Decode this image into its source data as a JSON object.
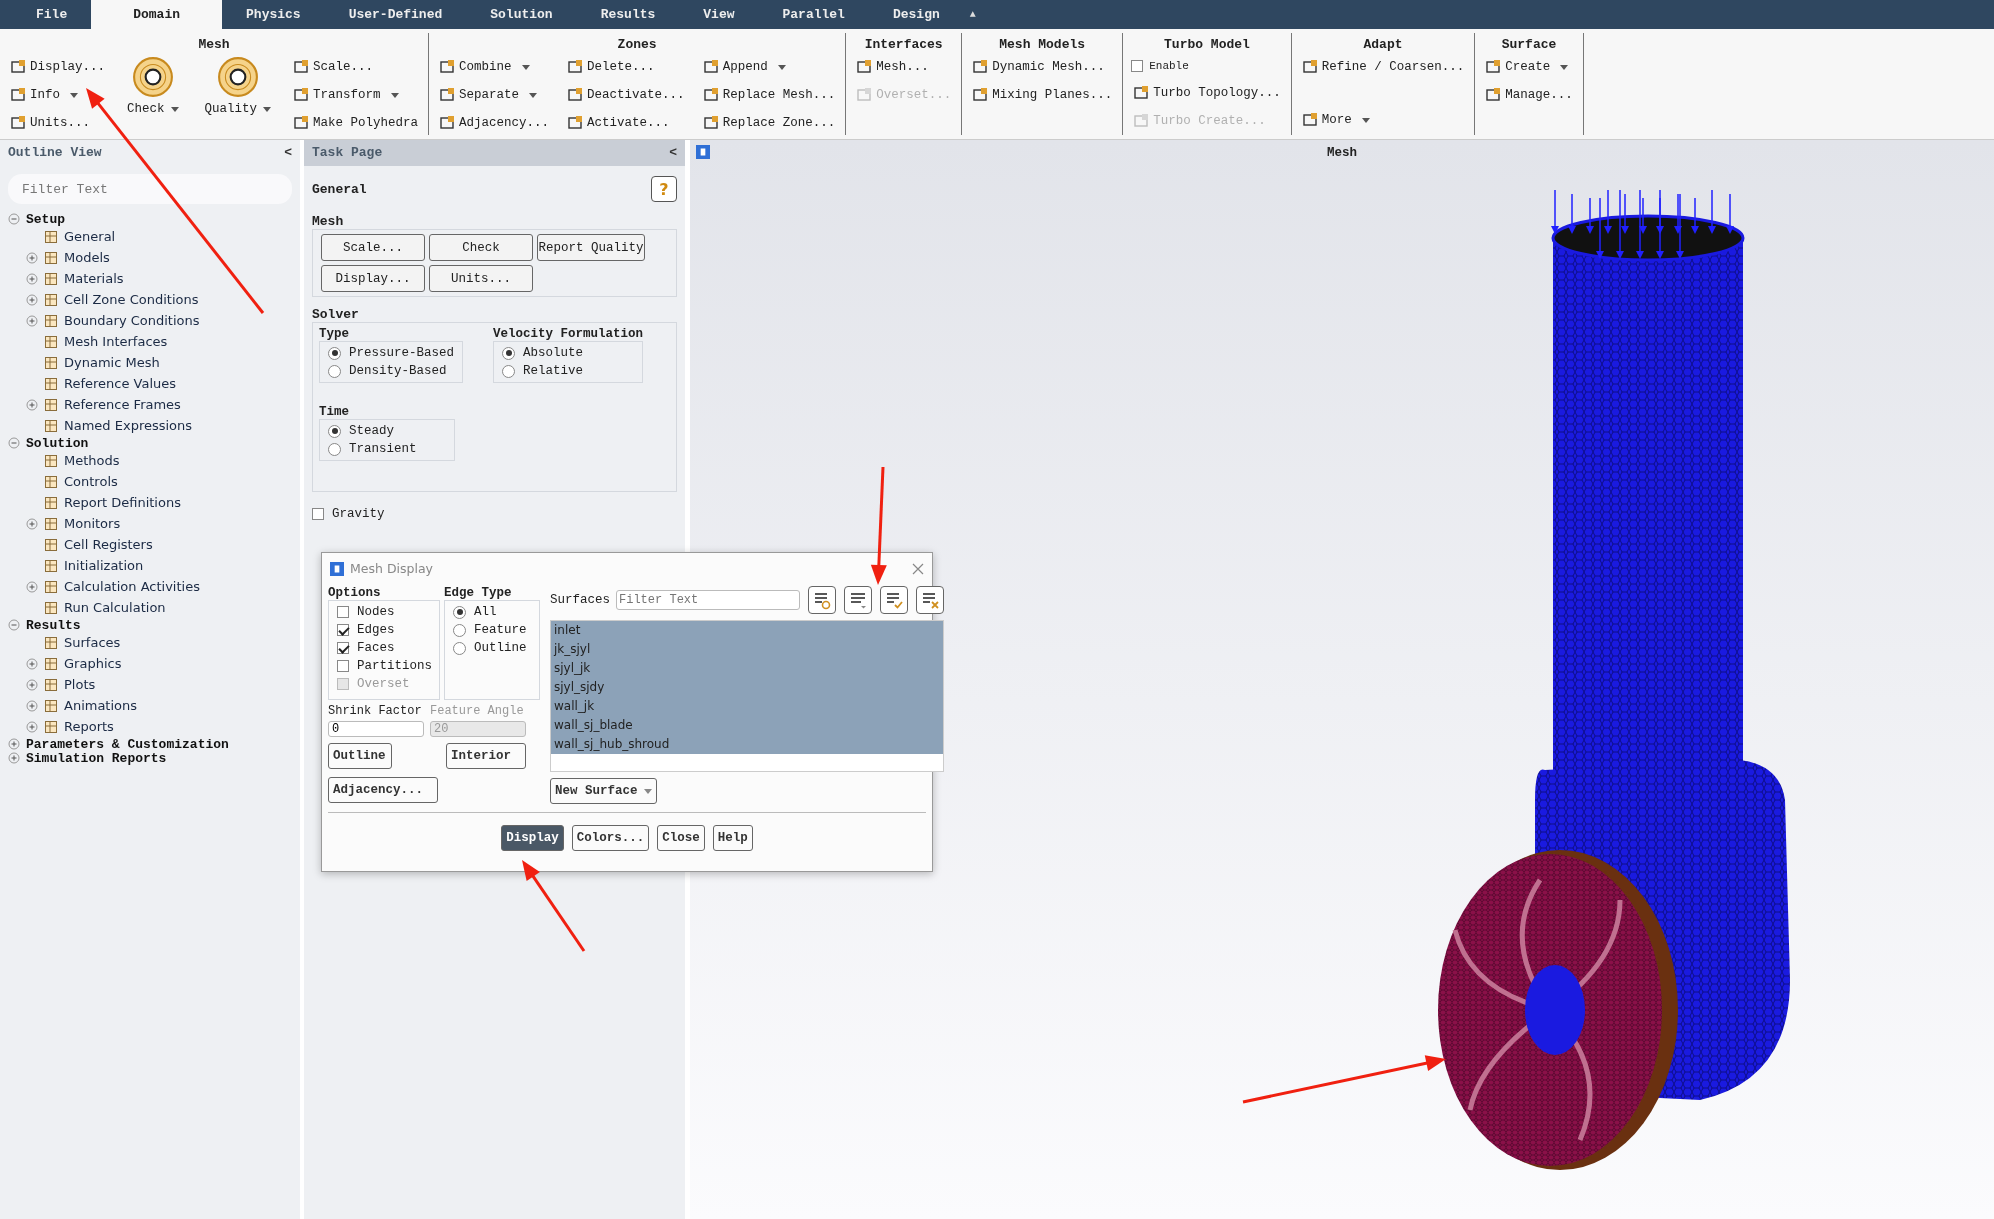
{
  "tabs": [
    {
      "label": "File",
      "selected": false
    },
    {
      "label": "Domain",
      "selected": true
    },
    {
      "label": "Physics",
      "selected": false
    },
    {
      "label": "User-Defined",
      "selected": false
    },
    {
      "label": "Solution",
      "selected": false
    },
    {
      "label": "Results",
      "selected": false
    },
    {
      "label": "View",
      "selected": false
    },
    {
      "label": "Parallel",
      "selected": false
    },
    {
      "label": "Design",
      "selected": false
    }
  ],
  "ribbon_collapse": "▲",
  "ribbon": [
    {
      "title": "Mesh",
      "columns": [
        {
          "items": [
            {
              "kind": "button",
              "label": "Display...",
              "dropdown": false,
              "disabled": false
            },
            {
              "kind": "button",
              "label": "Info",
              "dropdown": true,
              "disabled": false
            },
            {
              "kind": "button",
              "label": "Units...",
              "dropdown": false,
              "disabled": false
            }
          ]
        },
        {
          "items": [
            {
              "kind": "big",
              "label": "Check",
              "dropdown": true
            }
          ]
        },
        {
          "items": [
            {
              "kind": "big",
              "label": "Quality",
              "dropdown": true
            }
          ]
        },
        {
          "items": [
            {
              "kind": "button",
              "label": "Scale...",
              "dropdown": false,
              "disabled": false
            },
            {
              "kind": "button",
              "label": "Transform",
              "dropdown": true,
              "disabled": false
            },
            {
              "kind": "button",
              "label": "Make Polyhedra",
              "dropdown": false,
              "disabled": false
            }
          ]
        }
      ]
    },
    {
      "title": "Zones",
      "columns": [
        {
          "items": [
            {
              "kind": "button",
              "label": "Combine",
              "dropdown": true,
              "disabled": false
            },
            {
              "kind": "button",
              "label": "Separate",
              "dropdown": true,
              "disabled": false
            },
            {
              "kind": "button",
              "label": "Adjacency...",
              "dropdown": false,
              "disabled": false
            }
          ]
        },
        {
          "items": [
            {
              "kind": "button",
              "label": "Delete...",
              "dropdown": false,
              "disabled": false
            },
            {
              "kind": "button",
              "label": "Deactivate...",
              "dropdown": false,
              "disabled": false
            },
            {
              "kind": "button",
              "label": "Activate...",
              "dropdown": false,
              "disabled": false
            }
          ]
        },
        {
          "items": [
            {
              "kind": "button",
              "label": "Append",
              "dropdown": true,
              "disabled": false
            },
            {
              "kind": "button",
              "label": "Replace Mesh...",
              "dropdown": false,
              "disabled": false
            },
            {
              "kind": "button",
              "label": "Replace Zone...",
              "dropdown": false,
              "disabled": false
            }
          ]
        }
      ]
    },
    {
      "title": "Interfaces",
      "columns": [
        {
          "items": [
            {
              "kind": "button",
              "label": "Mesh...",
              "dropdown": false,
              "disabled": false
            },
            {
              "kind": "button",
              "label": "Overset...",
              "dropdown": false,
              "disabled": true
            }
          ]
        }
      ]
    },
    {
      "title": "Mesh Models",
      "columns": [
        {
          "items": [
            {
              "kind": "button",
              "label": "Dynamic Mesh...",
              "dropdown": false,
              "disabled": false
            },
            {
              "kind": "button",
              "label": "Mixing Planes...",
              "dropdown": false,
              "disabled": false
            }
          ]
        }
      ]
    },
    {
      "title": "Turbo Model",
      "columns": [
        {
          "items": [
            {
              "kind": "checkbox",
              "label": "Enable",
              "checked": false
            },
            {
              "kind": "button",
              "label": "Turbo Topology...",
              "dropdown": false,
              "disabled": false
            },
            {
              "kind": "button",
              "label": "Turbo Create...",
              "dropdown": false,
              "disabled": true
            }
          ]
        }
      ]
    },
    {
      "title": "Adapt",
      "columns": [
        {
          "spread": true,
          "items": [
            {
              "kind": "button",
              "label": "Refine / Coarsen...",
              "dropdown": false,
              "disabled": false
            },
            {
              "kind": "button",
              "label": "More",
              "dropdown": true,
              "disabled": false
            }
          ]
        }
      ]
    },
    {
      "title": "Surface",
      "columns": [
        {
          "items": [
            {
              "kind": "button",
              "label": "Create",
              "dropdown": true,
              "disabled": false
            },
            {
              "kind": "button",
              "label": "Manage...",
              "dropdown": false,
              "disabled": false
            }
          ]
        }
      ]
    }
  ],
  "outline": {
    "title": "Outline View",
    "collapse": "<",
    "filter": {
      "placeholder": "Filter Text"
    },
    "tree": [
      {
        "label": "Setup",
        "expanded": true,
        "children": [
          {
            "label": "General",
            "has_children": false
          },
          {
            "label": "Models",
            "has_children": true
          },
          {
            "label": "Materials",
            "has_children": true
          },
          {
            "label": "Cell Zone Conditions",
            "has_children": true
          },
          {
            "label": "Boundary Conditions",
            "has_children": true
          },
          {
            "label": "Mesh Interfaces",
            "has_children": false
          },
          {
            "label": "Dynamic Mesh",
            "has_children": false
          },
          {
            "label": "Reference Values",
            "has_children": false
          },
          {
            "label": "Reference Frames",
            "has_children": true
          },
          {
            "label": "Named Expressions",
            "has_children": false
          }
        ]
      },
      {
        "label": "Solution",
        "expanded": true,
        "children": [
          {
            "label": "Methods",
            "has_children": false
          },
          {
            "label": "Controls",
            "has_children": false
          },
          {
            "label": "Report Definitions",
            "has_children": false
          },
          {
            "label": "Monitors",
            "has_children": true
          },
          {
            "label": "Cell Registers",
            "has_children": false
          },
          {
            "label": "Initialization",
            "has_children": false
          },
          {
            "label": "Calculation Activities",
            "has_children": true
          },
          {
            "label": "Run Calculation",
            "has_children": false
          }
        ]
      },
      {
        "label": "Results",
        "expanded": true,
        "children": [
          {
            "label": "Surfaces",
            "has_children": false
          },
          {
            "label": "Graphics",
            "has_children": true
          },
          {
            "label": "Plots",
            "has_children": true
          },
          {
            "label": "Animations",
            "has_children": true
          },
          {
            "label": "Reports",
            "has_children": true
          }
        ]
      },
      {
        "label": "Parameters & Customization",
        "expanded": false
      },
      {
        "label": "Simulation Reports",
        "expanded": false
      }
    ]
  },
  "task_page": {
    "title": "Task Page",
    "collapse": "<",
    "heading": "General",
    "help": "?",
    "mesh": {
      "title": "Mesh",
      "buttons": [
        "Scale...",
        "Check",
        "Report Quality",
        "Display...",
        "Units..."
      ]
    },
    "solver": {
      "title": "Solver",
      "type": {
        "title": "Type",
        "options": [
          {
            "label": "Pressure-Based",
            "selected": true
          },
          {
            "label": "Density-Based",
            "selected": false
          }
        ]
      },
      "velocity": {
        "title": "Velocity Formulation",
        "options": [
          {
            "label": "Absolute",
            "selected": true
          },
          {
            "label": "Relative",
            "selected": false
          }
        ]
      },
      "time": {
        "title": "Time",
        "options": [
          {
            "label": "Steady",
            "selected": true
          },
          {
            "label": "Transient",
            "selected": false
          }
        ]
      }
    },
    "gravity": {
      "label": "Gravity",
      "checked": false
    }
  },
  "dialog": {
    "title": "Mesh Display",
    "options": {
      "title": "Options",
      "items": [
        {
          "label": "Nodes",
          "checked": false,
          "disabled": false
        },
        {
          "label": "Edges",
          "checked": true,
          "disabled": false
        },
        {
          "label": "Faces",
          "checked": true,
          "disabled": false
        },
        {
          "label": "Partitions",
          "checked": false,
          "disabled": false
        },
        {
          "label": "Overset",
          "checked": false,
          "disabled": true
        }
      ]
    },
    "edge_type": {
      "title": "Edge Type",
      "options": [
        {
          "label": "All",
          "selected": true
        },
        {
          "label": "Feature",
          "selected": false
        },
        {
          "label": "Outline",
          "selected": false
        }
      ]
    },
    "shrink_factor": {
      "label": "Shrink Factor",
      "value": "0",
      "disabled": false
    },
    "feature_angle": {
      "label": "Feature Angle",
      "value": "20",
      "disabled": true
    },
    "left_buttons": [
      "Outline",
      "Interior",
      "Adjacency..."
    ],
    "surfaces": {
      "label": "Surfaces",
      "filter": {
        "placeholder": "Filter Text"
      },
      "items": [
        {
          "label": "inlet",
          "selected": true
        },
        {
          "label": "jk_sjyl",
          "selected": true
        },
        {
          "label": "sjyl_jk",
          "selected": true
        },
        {
          "label": "sjyl_sjdy",
          "selected": true
        },
        {
          "label": "wall_jk",
          "selected": true
        },
        {
          "label": "wall_sj_blade",
          "selected": true
        },
        {
          "label": "wall_sj_hub_shroud",
          "selected": true
        }
      ]
    },
    "new_surface": "New Surface",
    "buttons": [
      {
        "label": "Display",
        "primary": true
      },
      {
        "label": "Colors...",
        "primary": false
      },
      {
        "label": "Close",
        "primary": false
      },
      {
        "label": "Help",
        "primary": false
      }
    ]
  },
  "viewport": {
    "title": "Mesh"
  }
}
